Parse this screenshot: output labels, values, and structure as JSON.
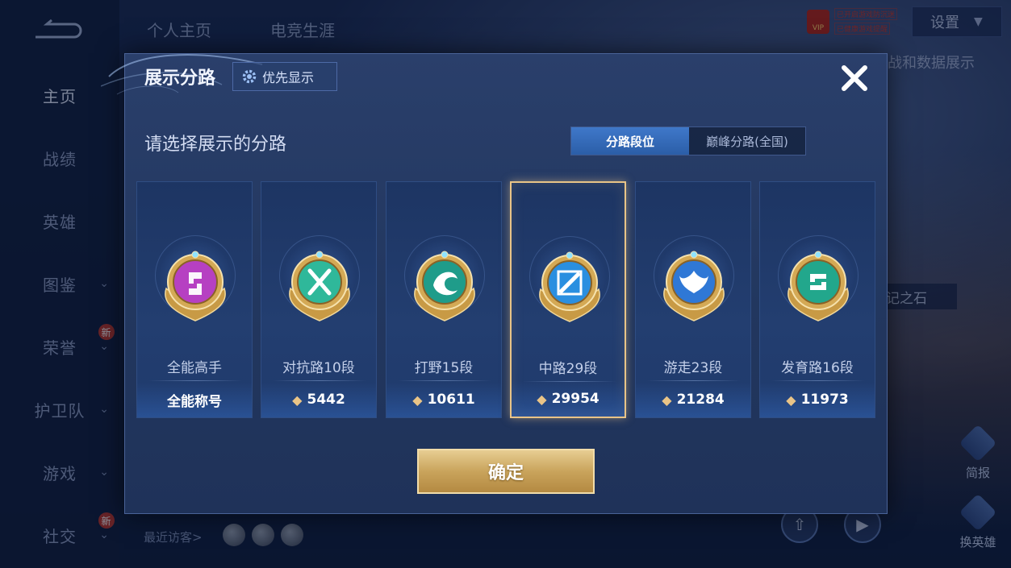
{
  "background": {
    "sidebar": [
      {
        "label": "主页",
        "active": true,
        "chevron": false,
        "new": false
      },
      {
        "label": "战绩",
        "active": false,
        "chevron": false,
        "new": false
      },
      {
        "label": "英雄",
        "active": false,
        "chevron": false,
        "new": false
      },
      {
        "label": "图鉴",
        "active": false,
        "chevron": true,
        "new": false
      },
      {
        "label": "荣誉",
        "active": false,
        "chevron": true,
        "new": true
      },
      {
        "label": "护卫队",
        "active": false,
        "chevron": true,
        "new": false
      },
      {
        "label": "游戏",
        "active": false,
        "chevron": true,
        "new": false
      },
      {
        "label": "社交",
        "active": false,
        "chevron": true,
        "new": true
      }
    ],
    "new_badge": "新",
    "top_tabs": [
      "个人主页",
      "电竞生涯"
    ],
    "settings_label": "设置",
    "vip_label": "VIP",
    "vip_notes": [
      "已开启游戏防沉迷",
      "已健康游戏提醒"
    ],
    "right_text": "战和数据展示",
    "stone_text": "记之石",
    "right_buttons": [
      "简报",
      "换英雄"
    ],
    "recent_visitors": "最近访客>"
  },
  "dialog": {
    "title": "展示分路",
    "priority_button": "优先显示",
    "prompt": "请选择展示的分路",
    "toggle": [
      {
        "label": "分路段位",
        "active": true
      },
      {
        "label": "巅峰分路(全国)",
        "active": false
      }
    ],
    "cards": [
      {
        "name": "全能高手",
        "footer": "全能称号",
        "points": null,
        "emblem": "all-round-emblem-icon",
        "color": "#b640c2",
        "selected": false
      },
      {
        "name": "对抗路10段",
        "footer": "5442",
        "points": true,
        "emblem": "clash-lane-emblem-icon",
        "color": "#2fb89a",
        "selected": false
      },
      {
        "name": "打野15段",
        "footer": "10611",
        "points": true,
        "emblem": "jungle-emblem-icon",
        "color": "#1f9c8a",
        "selected": false
      },
      {
        "name": "中路29段",
        "footer": "29954",
        "points": true,
        "emblem": "mid-lane-emblem-icon",
        "color": "#2a8fe0",
        "selected": true
      },
      {
        "name": "游走23段",
        "footer": "21284",
        "points": true,
        "emblem": "roam-emblem-icon",
        "color": "#2f78d6",
        "selected": false
      },
      {
        "name": "发育路16段",
        "footer": "11973",
        "points": true,
        "emblem": "farm-lane-emblem-icon",
        "color": "#22a78c",
        "selected": false
      }
    ],
    "confirm_button": "确定"
  },
  "colors": {
    "gold": "#e9c487",
    "dialog_bg": "#22375f",
    "toggle_active": "#2b5ea8"
  }
}
